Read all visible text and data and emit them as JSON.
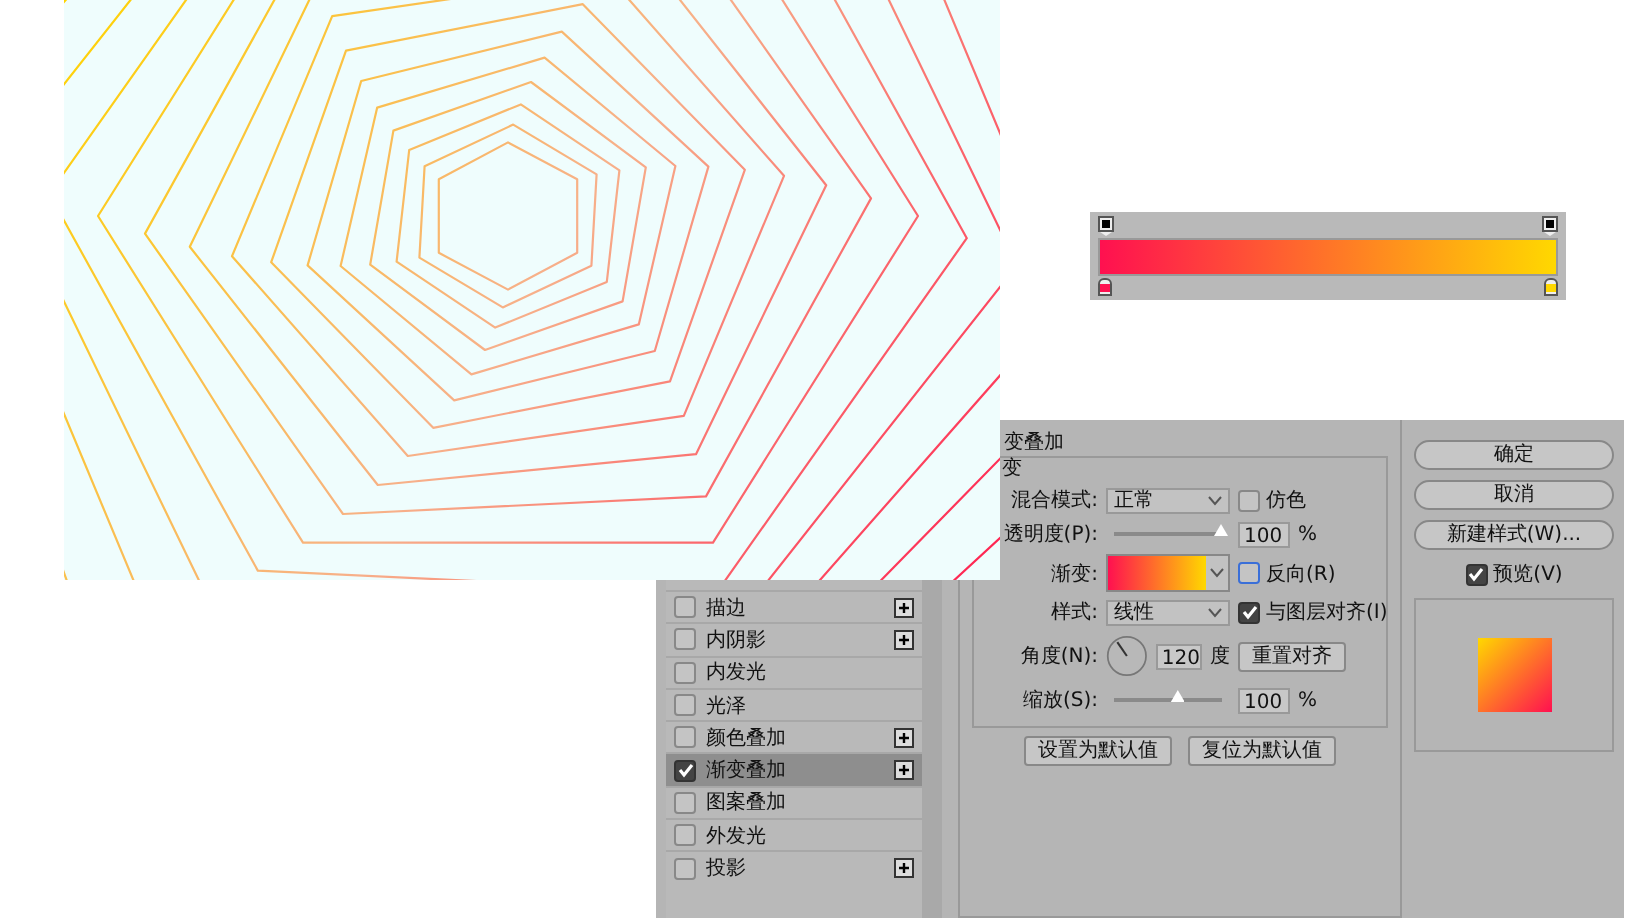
{
  "gradient_editor": {
    "color_stops": [
      {
        "color": "#ff1050"
      },
      {
        "color": "#ffd800"
      }
    ]
  },
  "layer_style_dialog": {
    "effects": [
      {
        "label": "描边",
        "checked": false,
        "selected": false,
        "has_add": true
      },
      {
        "label": "内阴影",
        "checked": false,
        "selected": false,
        "has_add": true
      },
      {
        "label": "内发光",
        "checked": false,
        "selected": false,
        "has_add": false
      },
      {
        "label": "光泽",
        "checked": false,
        "selected": false,
        "has_add": false
      },
      {
        "label": "颜色叠加",
        "checked": false,
        "selected": false,
        "has_add": true
      },
      {
        "label": "渐变叠加",
        "checked": true,
        "selected": true,
        "has_add": true
      },
      {
        "label": "图案叠加",
        "checked": false,
        "selected": false,
        "has_add": false
      },
      {
        "label": "外发光",
        "checked": false,
        "selected": false,
        "has_add": false
      },
      {
        "label": "投影",
        "checked": false,
        "selected": false,
        "has_add": true
      }
    ],
    "heading": "变叠加",
    "group_title": "变",
    "blend_mode": {
      "label": "混合模式:",
      "value": "正常"
    },
    "dither": {
      "label": "仿色",
      "checked": false
    },
    "opacity": {
      "label": "透明度(P):",
      "level": 1.0,
      "value": "100",
      "unit": "%"
    },
    "gradient": {
      "label": "渐变:"
    },
    "reverse": {
      "label": "反向(R)",
      "checked": false
    },
    "style": {
      "label": "样式:",
      "value": "线性"
    },
    "align": {
      "label": "与图层对齐(I)",
      "checked": true
    },
    "angle": {
      "label": "角度(N):",
      "value": "120",
      "unit": "度"
    },
    "reset_align_button": "重置对齐",
    "scale": {
      "label": "缩放(S):",
      "level": 0.6,
      "value": "100",
      "unit": "%"
    },
    "default_buttons": [
      "设置为默认值",
      "复位为默认值"
    ],
    "side_buttons": [
      "确定",
      "取消",
      "新建样式(W)..."
    ],
    "preview": {
      "label": "预览(V)",
      "checked": true
    }
  }
}
